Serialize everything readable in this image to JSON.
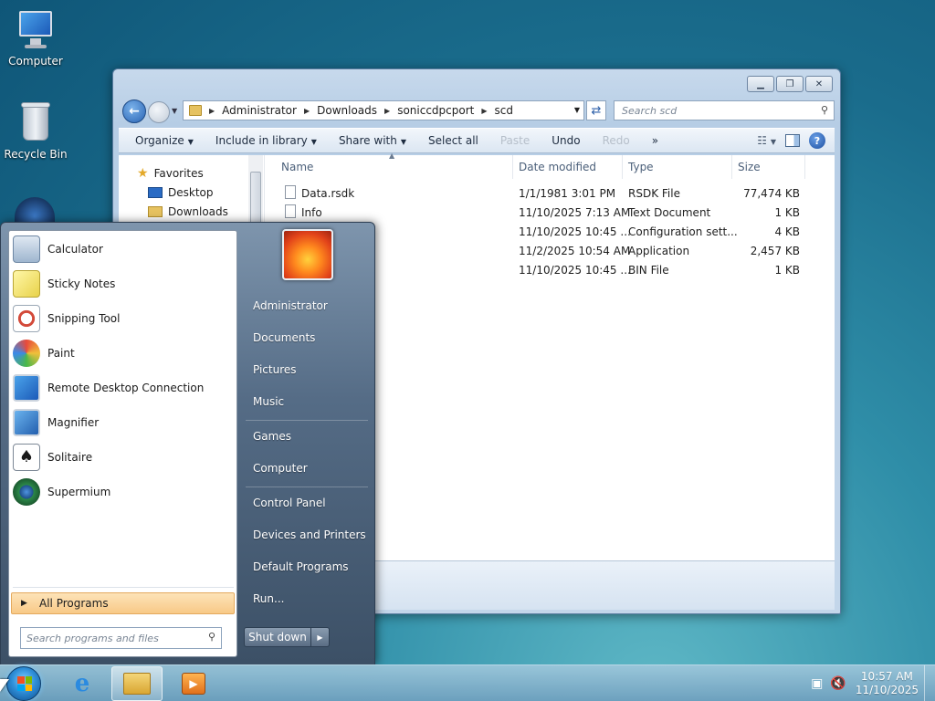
{
  "desktop": {
    "icons": [
      {
        "label": "Computer",
        "icon": "computer-icon"
      },
      {
        "label": "Recycle Bin",
        "icon": "recycle-bin-icon"
      }
    ]
  },
  "explorer": {
    "breadcrumb": [
      "Administrator",
      "Downloads",
      "soniccdpcport",
      "scd"
    ],
    "search_placeholder": "Search scd",
    "toolbar": {
      "organize": "Organize",
      "include_in_library": "Include in library",
      "share_with": "Share with",
      "select_all": "Select all",
      "paste": "Paste",
      "undo": "Undo",
      "redo": "Redo",
      "more": "»"
    },
    "nav_pane": {
      "favorites": "Favorites",
      "desktop": "Desktop",
      "downloads": "Downloads"
    },
    "columns": {
      "name": "Name",
      "date_modified": "Date modified",
      "type": "Type",
      "size": "Size"
    },
    "files": [
      {
        "name": "Data.rsdk",
        "date": "1/1/1981 3:01 PM",
        "type": "RSDK File",
        "size": "77,474 KB"
      },
      {
        "name": "Info",
        "date": "11/10/2025 7:13 AM",
        "type": "Text Document",
        "size": "1 KB"
      },
      {
        "name": "",
        "date": "11/10/2025 10:45 ...",
        "type": "Configuration sett...",
        "size": "4 KB"
      },
      {
        "name": "",
        "date": "11/2/2025 10:54 AM",
        "type": "Application",
        "size": "2,457 KB"
      },
      {
        "name": "",
        "date": "11/10/2025 10:45 ...",
        "type": "BIN File",
        "size": "1 KB"
      }
    ]
  },
  "start_menu": {
    "programs": [
      {
        "label": "Calculator",
        "icon": "calculator-icon"
      },
      {
        "label": "Sticky Notes",
        "icon": "sticky-notes-icon"
      },
      {
        "label": "Snipping Tool",
        "icon": "snipping-tool-icon"
      },
      {
        "label": "Paint",
        "icon": "paint-icon"
      },
      {
        "label": "Remote Desktop Connection",
        "icon": "remote-desktop-icon"
      },
      {
        "label": "Magnifier",
        "icon": "magnifier-icon"
      },
      {
        "label": "Solitaire",
        "icon": "solitaire-icon"
      },
      {
        "label": "Supermium",
        "icon": "supermium-icon"
      }
    ],
    "all_programs": "All Programs",
    "search_placeholder": "Search programs and files",
    "right_items": {
      "administrator": "Administrator",
      "documents": "Documents",
      "pictures": "Pictures",
      "music": "Music",
      "games": "Games",
      "computer": "Computer",
      "control_panel": "Control Panel",
      "devices_printers": "Devices and Printers",
      "default_programs": "Default Programs",
      "run": "Run..."
    },
    "shutdown": "Shut down"
  },
  "taskbar": {
    "clock_time": "10:57 AM",
    "clock_date": "11/10/2025"
  }
}
